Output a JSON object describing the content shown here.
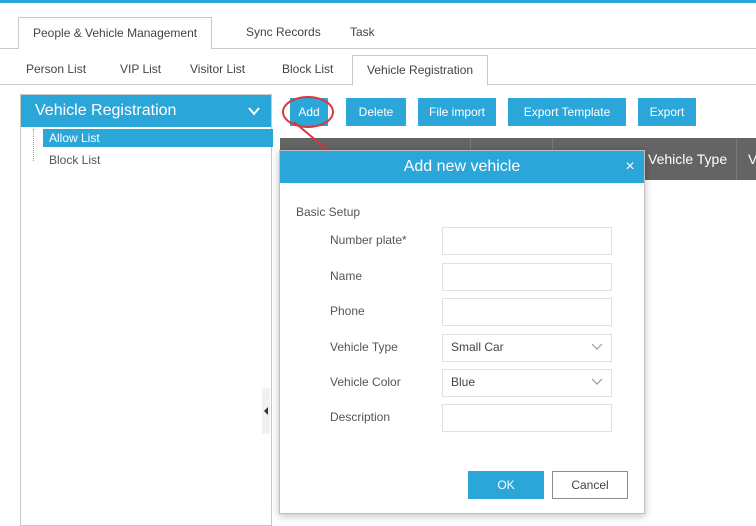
{
  "main_tabs": [
    {
      "label": "People & Vehicle Management"
    },
    {
      "label": "Sync Records"
    },
    {
      "label": "Task"
    }
  ],
  "sub_tabs": [
    {
      "label": "Person List"
    },
    {
      "label": "VIP List"
    },
    {
      "label": "Visitor List"
    },
    {
      "label": "Block List"
    },
    {
      "label": "Vehicle Registration"
    }
  ],
  "sidebar": {
    "title": "Vehicle Registration",
    "items": [
      {
        "label": "Allow List",
        "selected": true
      },
      {
        "label": "Block List",
        "selected": false
      }
    ]
  },
  "toolbar": {
    "add": "Add",
    "delete": "Delete",
    "file_import": "File import",
    "export_template": "Export Template",
    "export": "Export"
  },
  "table": {
    "columns": [
      "Vehicle Type",
      "V"
    ]
  },
  "dialog": {
    "title": "Add new vehicle",
    "close": "×",
    "section": "Basic Setup",
    "fields": [
      {
        "label": "Number plate*",
        "value": ""
      },
      {
        "label": "Name",
        "value": ""
      },
      {
        "label": "Phone",
        "value": ""
      },
      {
        "label": "Vehicle Type",
        "value": "Small Car"
      },
      {
        "label": "Vehicle Color",
        "value": "Blue"
      },
      {
        "label": "Description",
        "value": ""
      }
    ],
    "ok": "OK",
    "cancel": "Cancel"
  },
  "colors": {
    "accent": "#2aa6d8",
    "table_header": "#646464",
    "annotation": "#d9363e"
  }
}
